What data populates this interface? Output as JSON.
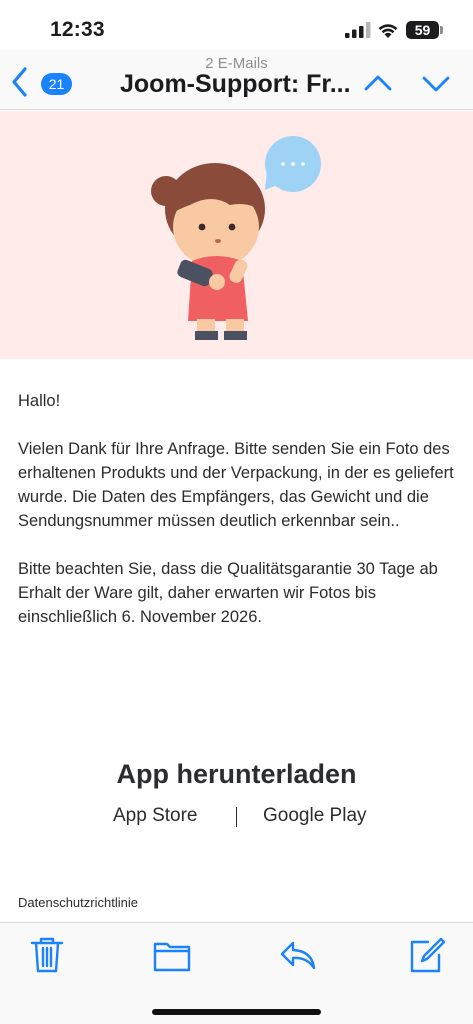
{
  "status_bar": {
    "time": "12:33",
    "battery_label": "59",
    "icons": [
      "signal-icon",
      "wifi-icon",
      "battery-icon"
    ]
  },
  "nav": {
    "back_count": "21",
    "subtitle": "2 E-Mails",
    "title": "Joom-Support: Fr...",
    "icons": [
      "back-chevron-icon",
      "chevron-up-icon",
      "chevron-down-icon"
    ],
    "accent_color": "#1a82fb"
  },
  "hero": {
    "background_color": "#feebea",
    "illustration": "girl-with-phone-illustration"
  },
  "email": {
    "greeting": "Hallo!",
    "paragraph_1": "Vielen Dank für Ihre Anfrage. Bitte senden Sie ein Foto des erhaltenen Produkts und der Verpackung, in der es geliefert wurde. Die Daten des Empfängers, das Gewicht und die Sendungsnummer müssen deutlich erkennbar sein..",
    "paragraph_2": "Bitte beachten Sie, dass die Qualitätsgarantie 30 Tage ab Erhalt der Ware gilt, daher erwarten wir Fotos bis einschließlich 6. November 2026."
  },
  "app_download": {
    "title": "App herunterladen",
    "app_store": "App Store",
    "google_play": "Google Play"
  },
  "footer": {
    "privacy_link": "Datenschutzrichtlinie"
  },
  "toolbar": {
    "icons": [
      "trash-icon",
      "folder-icon",
      "reply-icon",
      "compose-icon"
    ]
  }
}
